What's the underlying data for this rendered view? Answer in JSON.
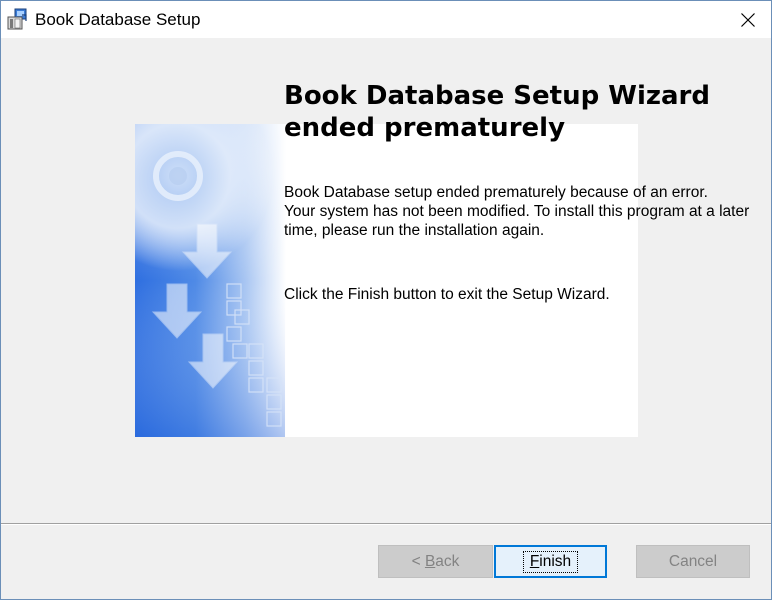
{
  "window": {
    "title": "Book Database Setup",
    "icon": "installer-box-icon",
    "close_icon": "close-icon"
  },
  "main": {
    "heading": "Book Database Setup Wizard ended prematurely",
    "message": "Book Database setup ended prematurely because of an error.\nYour system has not been modified.  To install this program at a later time, please run the installation again.",
    "instruction": "Click the Finish button to exit the Setup Wizard."
  },
  "buttons": {
    "back": {
      "prefix": "< ",
      "accel": "B",
      "rest": "ack",
      "enabled": false
    },
    "finish": {
      "accel": "F",
      "rest": "inish",
      "enabled": true,
      "default": true
    },
    "cancel": {
      "label": "Cancel",
      "enabled": false
    }
  },
  "colors": {
    "banner_blue": "#2f6fe0",
    "focus_border": "#0078d7",
    "dialog_bg": "#f0f0f0"
  }
}
